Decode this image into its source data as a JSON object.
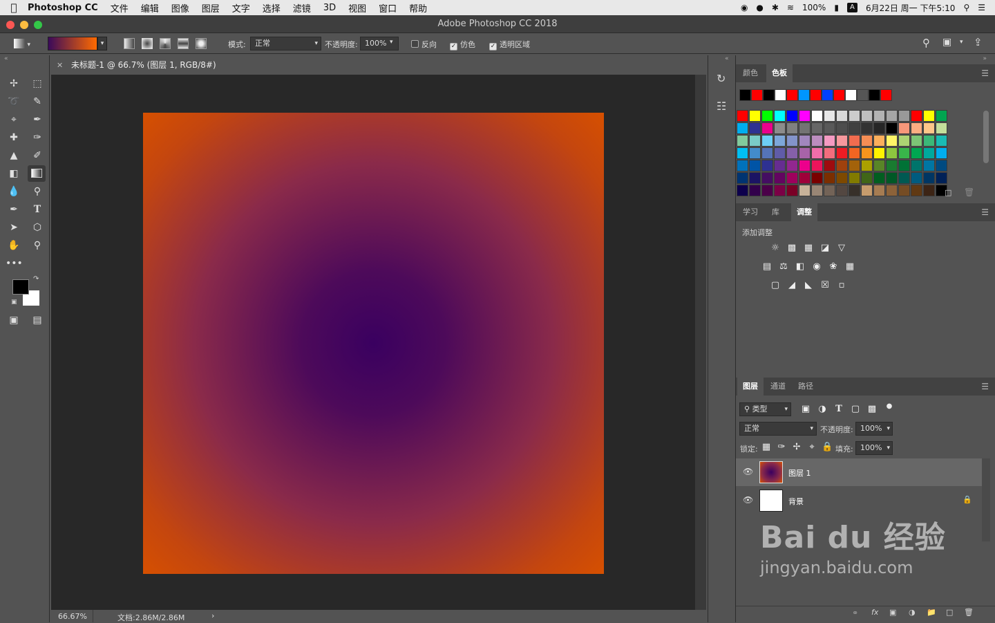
{
  "menubar": {
    "app_name": "Photoshop CC",
    "items": [
      "文件",
      "编辑",
      "图像",
      "图层",
      "文字",
      "选择",
      "滤镜",
      "3D",
      "视图",
      "窗口",
      "帮助"
    ],
    "battery": "100%",
    "input_method": "A",
    "datetime": "6月22日 周一 下午5:10"
  },
  "window": {
    "title": "Adobe Photoshop CC 2018"
  },
  "options": {
    "mode_label": "模式:",
    "mode_value": "正常",
    "opacity_label": "不透明度:",
    "opacity_value": "100%",
    "reverse_label": "反向",
    "dither_label": "仿色",
    "transparency_label": "透明区域"
  },
  "document": {
    "tab_title": "未标题-1 @ 66.7% (图层 1, RGB/8#) *",
    "zoom": "66.67%",
    "doc_info": "文档:2.86M/2.86M"
  },
  "panels": {
    "color_tabs": [
      "颜色",
      "色板"
    ],
    "adjust_tabs": [
      "学习",
      "库",
      "调整"
    ],
    "add_adjustment": "添加调整",
    "layer_tabs": [
      "图层",
      "通道",
      "路径"
    ],
    "filter_kind": "类型",
    "blend_mode": "正常",
    "opacity_label": "不透明度:",
    "opacity_value": "100%",
    "lock_label": "锁定:",
    "fill_label": "填充:",
    "fill_value": "100%",
    "layers": [
      {
        "name": "图层 1"
      },
      {
        "name": "背景"
      }
    ]
  },
  "swatches": {
    "recent": [
      "#000000",
      "#ff0000",
      "#000000",
      "#ffffff",
      "#ff0000",
      "#0096ff",
      "#ff0000",
      "#0040ff",
      "#ff0000",
      "#ffffff",
      "#555555",
      "#000000",
      "#ff0000"
    ],
    "grid": [
      [
        "#ff0000",
        "#ffff00",
        "#00ff00",
        "#00ffff",
        "#0000ff",
        "#ff00ff",
        "#ffffff",
        "#e6e6e6",
        "#d9d9d9",
        "#cccccc",
        "#bfbfbf",
        "#b3b3b3",
        "#a6a6a6",
        "#999999",
        "#ff0000",
        "#ffff00",
        "#00a550"
      ],
      [
        "#00aeef",
        "#2e3192",
        "#ec008c",
        "#8c8c8c",
        "#808080",
        "#737373",
        "#666666",
        "#595959",
        "#4d4d4d",
        "#404040",
        "#333333",
        "#262626",
        "#000000",
        "#f7977a",
        "#fbad82",
        "#fdc689",
        "#c4df9b"
      ],
      [
        "#82ca9c",
        "#7accc8",
        "#6dcff6",
        "#7da7d9",
        "#8393ca",
        "#a187be",
        "#bc8dbf",
        "#f49ac2",
        "#f6989d",
        "#f26c4f",
        "#f68e55",
        "#fbaf5c",
        "#fff467",
        "#acd373",
        "#7cc576",
        "#3bb878",
        "#1abbb4"
      ],
      [
        "#00bff3",
        "#438ccb",
        "#5574b9",
        "#605ca8",
        "#8560a8",
        "#a863a8",
        "#f06eaa",
        "#f26d7d",
        "#ed1c24",
        "#f26522",
        "#f7941d",
        "#fff200",
        "#8dc63f",
        "#39b54a",
        "#00a651",
        "#00a99d",
        "#00aeef"
      ],
      [
        "#0072bc",
        "#0054a6",
        "#2e3192",
        "#662d91",
        "#92278f",
        "#ec008c",
        "#ed145b",
        "#9e0b0f",
        "#a0410d",
        "#a3620a",
        "#aba000",
        "#598527",
        "#197b30",
        "#007236",
        "#00746b",
        "#0076a3",
        "#004a80"
      ],
      [
        "#003471",
        "#1b1464",
        "#440e62",
        "#630460",
        "#9e005d",
        "#9e0039",
        "#790000",
        "#7b2e00",
        "#7d4900",
        "#827b00",
        "#406618",
        "#005e20",
        "#005826",
        "#005952",
        "#005b7f",
        "#003663",
        "#002157"
      ],
      [
        "#0d004c",
        "#32004b",
        "#4b0049",
        "#7b0046",
        "#7a0026",
        "#c7b299",
        "#998675",
        "#736357",
        "#534741",
        "#37302a",
        "#c69c6d",
        "#a67c52",
        "#8c6239",
        "#754c24",
        "#603913",
        "#3c2415",
        "#000000"
      ]
    ]
  },
  "watermark": {
    "brand": "Bai du 经验",
    "url": "jingyan.baidu.com"
  },
  "colors": {
    "foreground": "#000000",
    "background": "#ffffff"
  }
}
